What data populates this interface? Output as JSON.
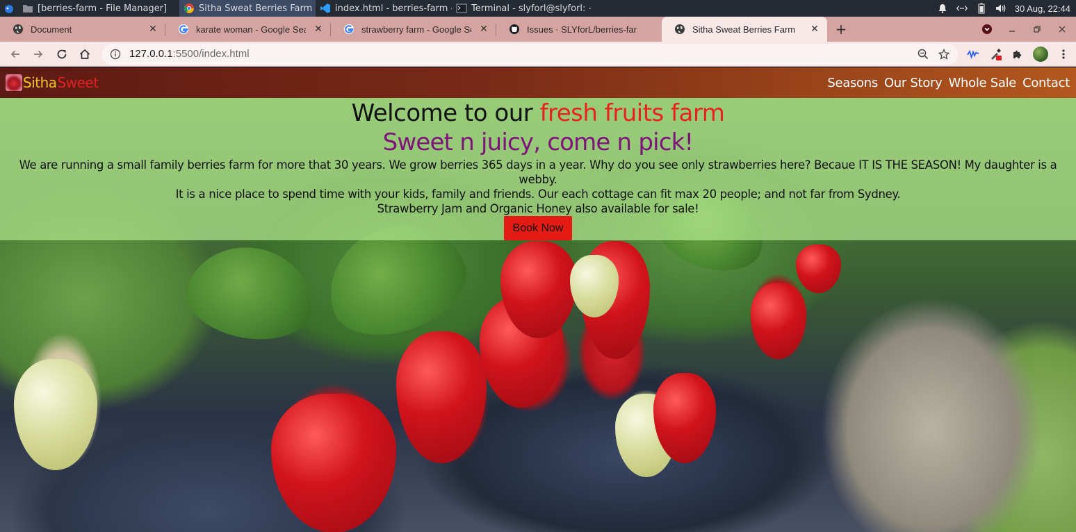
{
  "os_taskbar": {
    "tasks": [
      {
        "label": "[berries-farm - File Manager]",
        "icon": "folder-icon"
      },
      {
        "label": "Sitha Sweat Berries Farm - ...",
        "icon": "chrome-icon",
        "active": true
      },
      {
        "label": "index.html - berries-farm - V...",
        "icon": "vscode-icon"
      },
      {
        "label": "Terminal - slyforl@slyforl: ~/...",
        "icon": "terminal-icon"
      }
    ],
    "clock": "30 Aug, 22:44"
  },
  "browser": {
    "tabs": [
      {
        "label": "Document",
        "icon": "globe-icon"
      },
      {
        "label": "karate woman - Google Search",
        "icon": "google-icon"
      },
      {
        "label": "strawberry farm - Google Search",
        "icon": "google-icon"
      },
      {
        "label": "Issues · SLYforL/berries-farm",
        "icon": "github-icon"
      },
      {
        "label": "Sitha Sweat Berries Farm",
        "icon": "globe-icon",
        "active": true
      }
    ],
    "new_tab": "+",
    "url_host": "127.0.0.1",
    "url_rest": ":5500/index.html"
  },
  "page": {
    "brand": {
      "part1": "Sitha",
      "part2": "Sweet"
    },
    "nav": [
      "Seasons",
      "Our Story",
      "Whole Sale",
      "Contact"
    ],
    "hero": {
      "title_prefix": "Welcome to our ",
      "title_accent": "fresh fruits farm",
      "subtitle": "Sweet n juicy, come n pick!",
      "paragraph1": "We are running a small family berries farm for more that 30 years. We grow berries 365 days in a year. Why do you see only strawberries here? Becaue IT IS THE SEASON! My daughter is a webby.",
      "paragraph2": "It is a nice place to spend time with your kids, family and friends. Our each cottage can fit max 20 people; and not far from Sydney.",
      "paragraph3": "Strawberry Jam and Organic Honey also available for sale!",
      "cta": "Book Now"
    }
  },
  "colors": {
    "taskbar": "#252a33",
    "tabstrip": "#d6a4a0",
    "toolbar": "#f7e8e7",
    "brand_yellow": "#f0c418",
    "brand_red": "#e12222",
    "hero_overlay": "#b2e48e",
    "title_accent": "#e8231c",
    "subtitle": "#7d1479",
    "cta": "#e41b12"
  }
}
